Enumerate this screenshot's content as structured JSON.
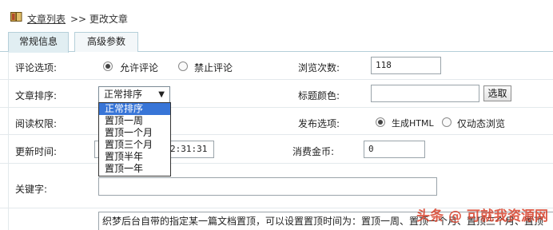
{
  "breadcrumb": {
    "link": "文章列表",
    "separator": ">> 更改文章"
  },
  "tabs": [
    {
      "label": "常规信息"
    },
    {
      "label": "高级参数"
    }
  ],
  "form": {
    "comment": {
      "label": "评论选项:",
      "options": [
        "允许评论",
        "禁止评论"
      ],
      "selected": "允许评论"
    },
    "views": {
      "label": "浏览次数:",
      "value": "118"
    },
    "sort": {
      "label": "文章排序:",
      "selected": "正常排序",
      "options": [
        "正常排序",
        "置顶一周",
        "置顶一个月",
        "置顶三个月",
        "置顶半年",
        "置顶一年"
      ]
    },
    "title_color": {
      "label": "标题颜色:",
      "value": "",
      "button": "选取"
    },
    "read_access": {
      "label": "阅读权限:"
    },
    "publish": {
      "label": "发布选项:",
      "options": [
        "生成HTML",
        "仅动态浏览"
      ],
      "selected": "生成HTML"
    },
    "update_time": {
      "label": "更新时间:",
      "value_visible": "2:31:31"
    },
    "gold": {
      "label": "消费金币:",
      "value": "0"
    },
    "keywords": {
      "label": "关键字:",
      "value": ""
    },
    "summary": {
      "text": "织梦后台自带的指定某一篇文档置顶，可以设置置顶时间为：置顶一周、置顶一个月、置顶三个月、置顶"
    }
  },
  "watermark": "头条 @ 可就我资源网"
}
